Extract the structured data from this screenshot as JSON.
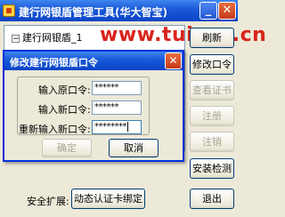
{
  "window": {
    "title": "建行网银盾管理工具(华大智宝)",
    "minimize_glyph": "_",
    "close_glyph": "✕"
  },
  "tree": {
    "expander": "−",
    "item": "建行网银盾_1"
  },
  "watermark": "www.tuiaxc.cn",
  "side_buttons": {
    "refresh": "刷新",
    "change_pin": "修改口令",
    "view_cert": "查看证书",
    "register": "注册",
    "unregister": "注销",
    "install_check": "安装检测"
  },
  "bottom": {
    "security_label": "安全扩展:",
    "bind_button": "动态认证卡绑定",
    "exit_button": "退出"
  },
  "dialog": {
    "title": "修改建行网银盾口令",
    "close_glyph": "✕",
    "old_pin_label": "输入原口令:",
    "old_pin_value": "******",
    "new_pin_label": "输入新口令:",
    "new_pin_value": "******",
    "confirm_pin_label": "重新输入新口令:",
    "confirm_pin_value": "********",
    "ok_button": "确定",
    "cancel_button": "取消"
  },
  "colors": {
    "titlebar": "#1958d8",
    "watermark": "#d8241c",
    "disabled_text": "#a8a592"
  }
}
